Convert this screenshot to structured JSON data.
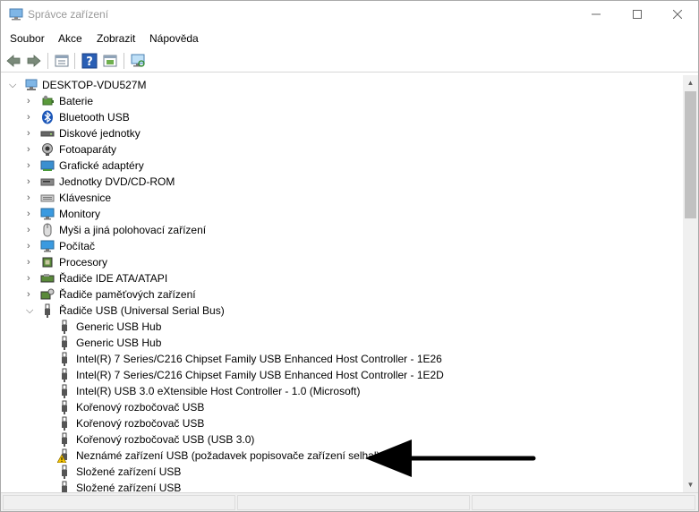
{
  "window": {
    "title": "Správce zařízení"
  },
  "menu": [
    "Soubor",
    "Akce",
    "Zobrazit",
    "Nápověda"
  ],
  "toolbar_icons": [
    "back-arrow-icon",
    "forward-arrow-icon",
    "properties-icon",
    "help-icon",
    "update-driver-icon",
    "scan-hardware-icon"
  ],
  "tree": {
    "root": "DESKTOP-VDU527M",
    "categories": [
      {
        "label": "Baterie",
        "icon": "battery-icon"
      },
      {
        "label": "Bluetooth USB",
        "icon": "bluetooth-icon"
      },
      {
        "label": "Diskové jednotky",
        "icon": "disk-drive-icon"
      },
      {
        "label": "Fotoaparáty",
        "icon": "camera-icon"
      },
      {
        "label": "Grafické adaptéry",
        "icon": "display-adapter-icon"
      },
      {
        "label": "Jednotky DVD/CD-ROM",
        "icon": "dvd-drive-icon"
      },
      {
        "label": "Klávesnice",
        "icon": "keyboard-icon"
      },
      {
        "label": "Monitory",
        "icon": "monitor-icon"
      },
      {
        "label": "Myši a jiná polohovací zařízení",
        "icon": "mouse-icon"
      },
      {
        "label": "Počítač",
        "icon": "computer-icon"
      },
      {
        "label": "Procesory",
        "icon": "processor-icon"
      },
      {
        "label": "Řadiče IDE ATA/ATAPI",
        "icon": "ide-controller-icon"
      },
      {
        "label": "Řadiče paměťových zařízení",
        "icon": "storage-controller-icon"
      },
      {
        "label": "Řadiče USB (Universal Serial Bus)",
        "icon": "usb-icon",
        "expanded": true
      }
    ],
    "usb_children": [
      {
        "label": "Generic USB Hub",
        "warning": false
      },
      {
        "label": "Generic USB Hub",
        "warning": false
      },
      {
        "label": "Intel(R) 7 Series/C216 Chipset Family USB Enhanced Host Controller - 1E26",
        "warning": false
      },
      {
        "label": "Intel(R) 7 Series/C216 Chipset Family USB Enhanced Host Controller - 1E2D",
        "warning": false
      },
      {
        "label": "Intel(R) USB 3.0 eXtensible Host Controller - 1.0 (Microsoft)",
        "warning": false
      },
      {
        "label": "Kořenový rozbočovač USB",
        "warning": false
      },
      {
        "label": "Kořenový rozbočovač USB",
        "warning": false
      },
      {
        "label": "Kořenový rozbočovač USB (USB 3.0)",
        "warning": false
      },
      {
        "label": "Neznámé zařízení USB (požadavek popisovače zařízení selhal)",
        "warning": true
      },
      {
        "label": "Složené zařízení USB",
        "warning": false
      },
      {
        "label": "Složené zařízení USB",
        "warning": false
      }
    ]
  },
  "colors": {
    "accent": "#0078d7",
    "warning": "#f5c400",
    "title_text": "#999999"
  }
}
